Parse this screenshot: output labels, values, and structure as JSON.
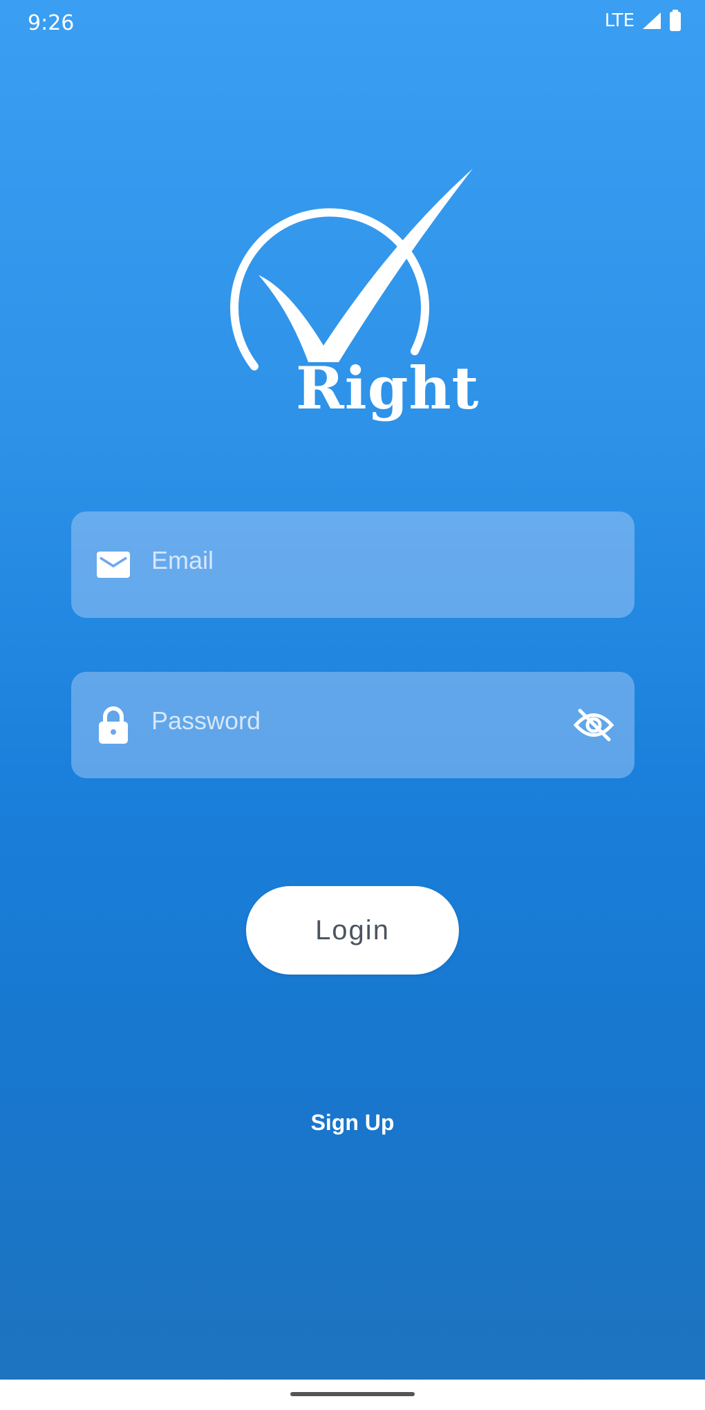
{
  "status_bar": {
    "time": "9:26",
    "network": "LTE"
  },
  "logo": {
    "text": "Right"
  },
  "form": {
    "email_placeholder": "Email",
    "password_placeholder": "Password"
  },
  "actions": {
    "login_label": "Login",
    "signup_label": "Sign Up"
  },
  "colors": {
    "background_top": "#3a9ff2",
    "background_bottom": "#1e73bd",
    "button": "#ffffff",
    "button_text": "#4b5560"
  },
  "icons": {
    "email": "envelope-icon",
    "password": "lock-icon",
    "toggle": "eye-off-icon",
    "signal": "signal-icon",
    "battery": "battery-icon"
  }
}
